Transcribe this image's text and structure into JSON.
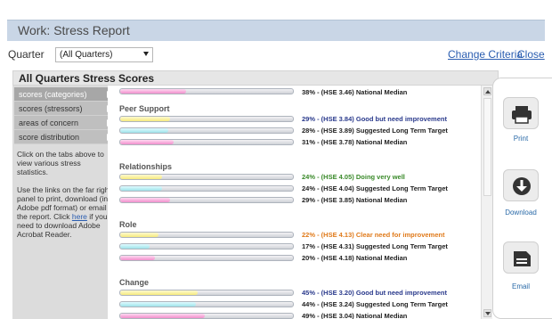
{
  "window_title": "Work: Stress Report",
  "quarter": {
    "label": "Quarter",
    "selected": "(All Quarters)"
  },
  "links": {
    "change_criteria": "Change Criteria",
    "close": "Close"
  },
  "panel_title": "All Quarters Stress Scores",
  "nav": {
    "items": [
      {
        "label": "scores (categories)",
        "active": true
      },
      {
        "label": "scores (stressors)",
        "active": false
      },
      {
        "label": "areas of concern",
        "active": false
      },
      {
        "label": "score distribution",
        "active": false
      }
    ],
    "help1": "Click on the tabs above to view various stress statistics.",
    "help2_before": "Use the links on the far right panel to print, download (in Adobe pdf format) or email the report. Click ",
    "help2_link": "here",
    "help2_after": " if you need to download Adobe Acrobat Reader."
  },
  "colors": {
    "improve": "#2a3a8c",
    "very_well": "#3a8a2a",
    "clear_need": "#e07a1a",
    "neutral": "#222222"
  },
  "top_row": {
    "text": "38% - (HSE 3.46) National Median",
    "fill": 0.38,
    "color": "pink"
  },
  "sections": [
    {
      "title": "Peer Support",
      "rows": [
        {
          "text": "29% - (HSE 3.84) Good but need improvement",
          "fill": 0.29,
          "color": "yellow",
          "status": "improve"
        },
        {
          "text": "28% - (HSE 3.89) Suggested Long Term Target",
          "fill": 0.28,
          "color": "cyan",
          "status": "neutral"
        },
        {
          "text": "31% - (HSE 3.78) National Median",
          "fill": 0.31,
          "color": "pink",
          "status": "neutral"
        }
      ]
    },
    {
      "title": "Relationships",
      "rows": [
        {
          "text": "24% - (HSE 4.05) Doing very well",
          "fill": 0.24,
          "color": "yellow",
          "status": "very_well"
        },
        {
          "text": "24% - (HSE 4.04) Suggested Long Term Target",
          "fill": 0.24,
          "color": "cyan",
          "status": "neutral"
        },
        {
          "text": "29% - (HSE 3.85) National Median",
          "fill": 0.29,
          "color": "pink",
          "status": "neutral"
        }
      ]
    },
    {
      "title": "Role",
      "rows": [
        {
          "text": "22% - (HSE 4.13) Clear need for improvement",
          "fill": 0.22,
          "color": "yellow",
          "status": "clear_need"
        },
        {
          "text": "17% - (HSE 4.31) Suggested Long Term Target",
          "fill": 0.17,
          "color": "cyan",
          "status": "neutral"
        },
        {
          "text": "20% - (HSE 4.18) National Median",
          "fill": 0.2,
          "color": "pink",
          "status": "neutral"
        }
      ]
    },
    {
      "title": "Change",
      "rows": [
        {
          "text": "45% - (HSE 3.20) Good but need improvement",
          "fill": 0.45,
          "color": "yellow",
          "status": "improve"
        },
        {
          "text": "44% - (HSE 3.24) Suggested Long Term Target",
          "fill": 0.44,
          "color": "cyan",
          "status": "neutral"
        },
        {
          "text": "49% - (HSE 3.04) National Median",
          "fill": 0.49,
          "color": "pink",
          "status": "neutral"
        }
      ]
    }
  ],
  "actions": [
    {
      "label": "Print",
      "icon": "printer-icon"
    },
    {
      "label": "Download",
      "icon": "download-icon"
    },
    {
      "label": "Email",
      "icon": "email-icon"
    }
  ]
}
